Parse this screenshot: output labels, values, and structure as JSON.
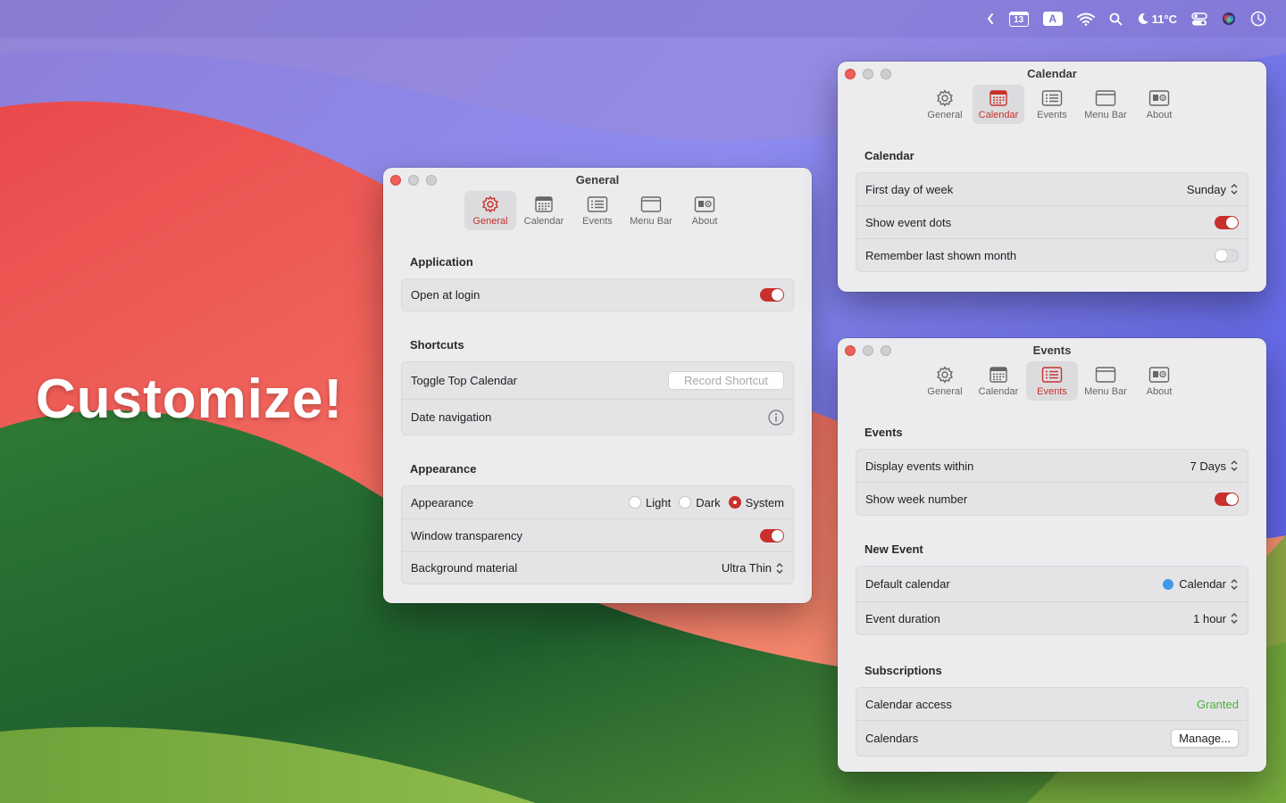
{
  "menubar": {
    "date_badge": "13",
    "input_badge": "A",
    "weather": "11°C"
  },
  "headline": "Customize!",
  "colors": {
    "accent": "#c8302b",
    "granted": "#4cae3d",
    "calendar_dot": "#3f98e8"
  },
  "tabs": [
    {
      "label": "General",
      "icon": "gear-icon"
    },
    {
      "label": "Calendar",
      "icon": "calendar-icon"
    },
    {
      "label": "Events",
      "icon": "list-icon"
    },
    {
      "label": "Menu Bar",
      "icon": "window-icon"
    },
    {
      "label": "About",
      "icon": "id-card-icon"
    }
  ],
  "general_window": {
    "title": "General",
    "active_tab": "General",
    "application": {
      "title": "Application",
      "open_at_login": {
        "label": "Open at login",
        "on": true
      }
    },
    "shortcuts": {
      "title": "Shortcuts",
      "toggle_top_calendar": {
        "label": "Toggle Top Calendar",
        "button": "Record Shortcut"
      },
      "date_navigation": {
        "label": "Date navigation"
      }
    },
    "appearance": {
      "title": "Appearance",
      "appearance_row": {
        "label": "Appearance",
        "options": [
          "Light",
          "Dark",
          "System"
        ],
        "selected": "System"
      },
      "window_transparency": {
        "label": "Window transparency",
        "on": true
      },
      "background_material": {
        "label": "Background material",
        "value": "Ultra Thin"
      }
    }
  },
  "calendar_window": {
    "title": "Calendar",
    "active_tab": "Calendar",
    "section_title": "Calendar",
    "first_day": {
      "label": "First day of week",
      "value": "Sunday"
    },
    "event_dots": {
      "label": "Show event dots",
      "on": true
    },
    "remember_month": {
      "label": "Remember last shown month",
      "on": false
    }
  },
  "events_window": {
    "title": "Events",
    "active_tab": "Events",
    "events": {
      "title": "Events",
      "display_within": {
        "label": "Display events within",
        "value": "7 Days"
      },
      "week_number": {
        "label": "Show week number",
        "on": true
      }
    },
    "new_event": {
      "title": "New Event",
      "default_calendar": {
        "label": "Default calendar",
        "value": "Calendar"
      },
      "duration": {
        "label": "Event duration",
        "value": "1 hour"
      }
    },
    "subscriptions": {
      "title": "Subscriptions",
      "access": {
        "label": "Calendar access",
        "value": "Granted"
      },
      "calendars": {
        "label": "Calendars",
        "button": "Manage..."
      }
    }
  }
}
